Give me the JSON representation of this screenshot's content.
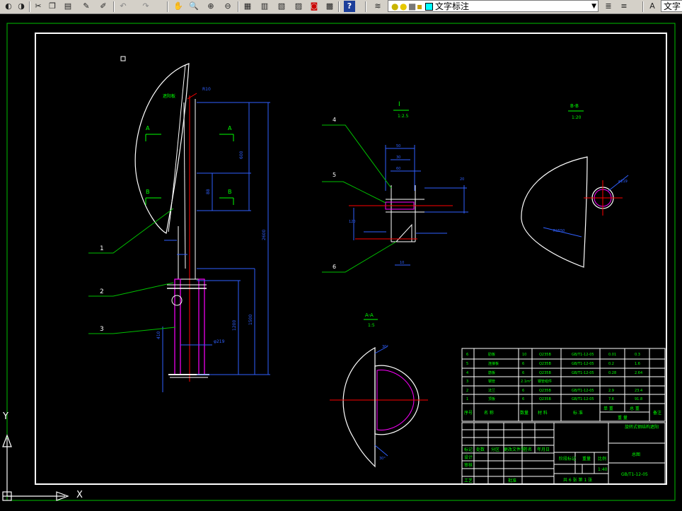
{
  "toolbar": {
    "icons": [
      "globe-icon",
      "cut-icon",
      "copy-icon",
      "paste-icon",
      "brush-icon",
      "match-prop-icon",
      "undo-icon",
      "redo-icon",
      "pan-icon",
      "zoom-realtime-icon",
      "zoom-window-icon",
      "zoom-previous-icon",
      "properties-icon",
      "design-center-icon",
      "tool-palette-icon",
      "sheet-set-icon",
      "markup-icon",
      "calculator-icon",
      "help-icon",
      "layer-manager-icon",
      "layer-state-icon",
      "bulb-icon",
      "sun-icon",
      "lock-icon",
      "color-square-icon",
      "layer-props-icon",
      "layer-prev-icon",
      "text-style-icon"
    ],
    "layer_combo_value": "文字标注",
    "text_style_value": "文字"
  },
  "drawing": {
    "views": {
      "detail_I_label": "I",
      "detail_I_scale": "1:2.5",
      "section_BB_label": "B-B",
      "section_BB_scale": "1:20",
      "section_AA_label": "A-A",
      "section_AA_scale": "1:5"
    },
    "callouts": [
      "1",
      "2",
      "3",
      "4",
      "5",
      "6"
    ],
    "main_view_text": "A",
    "bom_rows": [
      {
        "no": "6",
        "name": "肋板",
        "qty": "10",
        "material": "Q235B",
        "std": "GB/T1-12-05",
        "w1": "0.01",
        "w2": "0.3"
      },
      {
        "no": "5",
        "name": "连接板",
        "qty": "6",
        "material": "Q235B",
        "std": "GB/T1-12-05",
        "w1": "0.2",
        "w2": "1.6"
      },
      {
        "no": "4",
        "name": "筋板",
        "qty": "6",
        "material": "Q235B",
        "std": "GB/T1-12-05",
        "w1": "0.28",
        "w2": "2.64"
      },
      {
        "no": "3",
        "name": "钢管",
        "qty": "2.1m²",
        "material": "钢管组件",
        "std": "",
        "w1": "",
        "w2": ""
      },
      {
        "no": "2",
        "name": "法兰",
        "qty": "6",
        "material": "Q235B",
        "std": "GB/T1-12-05",
        "w1": "2.9",
        "w2": "23.4"
      },
      {
        "no": "1",
        "name": "顶板",
        "qty": "6",
        "material": "Q235B",
        "std": "GB/T1-12-05",
        "w1": "7.6",
        "w2": "91.8"
      }
    ],
    "bom_header": {
      "no": "序号",
      "name": "名  称",
      "qty": "数量",
      "material": "材  料",
      "std": "标  准",
      "weight": "单 重",
      "total": "总 重",
      "note": "备注",
      "mass": "重  量"
    },
    "title_block": {
      "project": "旋转式钢结构遮阳",
      "drawing_title": "总图",
      "drawing_no": "GB/T1-12-05",
      "stage_label": "阶段标记",
      "weight_label": "重量",
      "scale_label": "比例",
      "scale_value": "1:40",
      "sheet_info": "共 6 张  第 1 张",
      "rows": [
        "标记",
        "处数",
        "分区",
        "更改文件号",
        "签名",
        "年月日"
      ],
      "roles": [
        "设计",
        "审核",
        "工艺",
        "批准"
      ]
    },
    "ucs": {
      "y": "Y",
      "x": "X"
    }
  }
}
